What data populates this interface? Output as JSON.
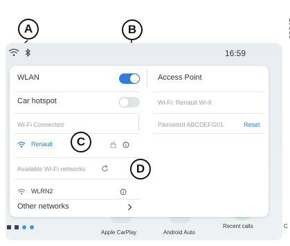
{
  "figure_ref": "69245",
  "callouts": {
    "a": "A",
    "b": "B",
    "c": "C",
    "d": "D"
  },
  "statusbar": {
    "time": "16:59",
    "wifi_icon": "wifi-icon",
    "bluetooth_icon": "bluetooth-icon"
  },
  "wlan": {
    "label": "WLAN",
    "on": true
  },
  "access_point": {
    "label": "Access Point"
  },
  "car_hotspot": {
    "label": "Car hotspot",
    "on": false
  },
  "wifi_name": {
    "label": "Wi-Fi: Renault Wi-fi"
  },
  "wifi_status": {
    "label": "Wi-Fi Connected"
  },
  "password": {
    "label": "Password ABCDEFG01",
    "reset": "Reset"
  },
  "connected_network": {
    "name": "Renault"
  },
  "available": {
    "label": "Available Wi-Fi networks"
  },
  "network_item": {
    "name": "WLRN2"
  },
  "other_networks": {
    "label": "Other networks"
  },
  "dock": {
    "items": [
      "Apple CarPlay",
      "Android Auto",
      "Recent calls",
      "C"
    ]
  },
  "colors": {
    "accent": "#2f7fd6",
    "toggle_off": "#e2e5e8"
  }
}
